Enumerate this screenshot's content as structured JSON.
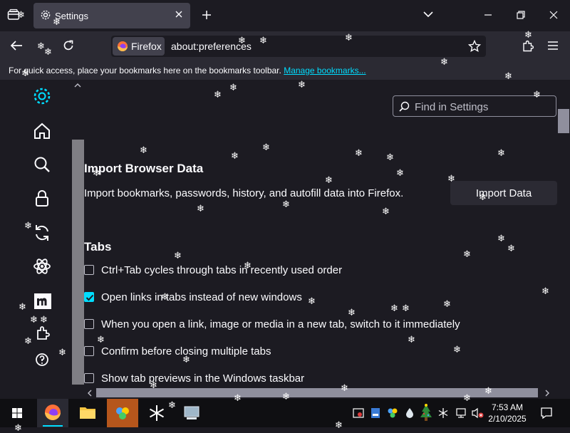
{
  "window": {
    "tab_title": "Settings"
  },
  "navbar": {
    "identity_label": "Firefox",
    "url": "about:preferences"
  },
  "bookmarks_toolbar": {
    "text": "For quick access, place your bookmarks here on the bookmarks toolbar.",
    "link": "Manage bookmarks..."
  },
  "sidebar": {
    "categories": [
      {
        "icon": "gear-icon",
        "name": "General"
      },
      {
        "icon": "home-icon",
        "name": "Home"
      },
      {
        "icon": "search-icon",
        "name": "Search"
      },
      {
        "icon": "lock-icon",
        "name": "Privacy & Security"
      },
      {
        "icon": "sync-icon",
        "name": "Sync"
      },
      {
        "icon": "atom-icon",
        "name": "Firefox Labs"
      },
      {
        "icon": "mozilla-m-icon",
        "name": "More from Mozilla"
      },
      {
        "icon": "extensions-icon",
        "name": "Extensions & Themes"
      },
      {
        "icon": "help-icon",
        "name": "Firefox Support"
      }
    ]
  },
  "search": {
    "placeholder": "Find in Settings"
  },
  "import": {
    "heading": "Import Browser Data",
    "description": "Import bookmarks, passwords, history, and autofill data into Firefox.",
    "button": "Import Data"
  },
  "tabs_section": {
    "heading": "Tabs",
    "options": [
      {
        "label": "Ctrl+Tab cycles through tabs in recently used order",
        "checked": false
      },
      {
        "label": "Open links in tabs instead of new windows",
        "checked": true
      },
      {
        "label": "When you open a link, image or media in a new tab, switch to it immediately",
        "checked": false
      },
      {
        "label": "Confirm before closing multiple tabs",
        "checked": false
      },
      {
        "label": "Show tab previews in the Windows taskbar",
        "checked": false
      }
    ]
  },
  "taskbar": {
    "time": "7:53 AM",
    "date": "2/10/2025"
  },
  "colors": {
    "accent": "#00ddff",
    "background": "#1c1b22",
    "toolbar": "#2b2a33"
  }
}
